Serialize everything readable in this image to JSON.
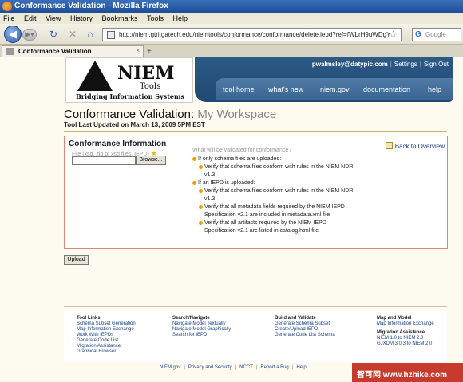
{
  "window": {
    "title": "Conformance Validation - Mozilla Firefox"
  },
  "menu": [
    "File",
    "Edit",
    "View",
    "History",
    "Bookmarks",
    "Tools",
    "Help"
  ],
  "address": {
    "url": "http://niem.gtri.gatech.edu/niemtools/conformance/conformance/delete.iepd?ref=fWLrH9uWDgY"
  },
  "search": {
    "placeholder": "Google",
    "engine_glyph": "G"
  },
  "tab": {
    "title": "Conformance Validation"
  },
  "logo": {
    "name": "NIEM",
    "sub": "Tools",
    "tagline": "Bridging Information Systems"
  },
  "header": {
    "email": "pwalmsley@datypic.com",
    "settings": "Settings",
    "signout": "Sign Out",
    "nav": [
      "tool home",
      "what's new",
      "niem.gov",
      "documentation",
      "help"
    ]
  },
  "page": {
    "title": "Conformance Validation:",
    "workspace": "My Workspace",
    "updated": "Tool Last Updated on March 13, 2009 5PM EST"
  },
  "conformance": {
    "heading": "Conformance Information",
    "file_label": "File (xsd, zip of xsd files, IEPD)",
    "browse": "Browse...",
    "what_label": "What will be validated for conformance?",
    "back": "Back to Overview",
    "rules": [
      {
        "level": 1,
        "text": "If only schema files are uploaded:"
      },
      {
        "level": 2,
        "text": "Verify that schema files conform with rules in the NIEM NDR"
      },
      {
        "level": 3,
        "text": "v1.3"
      },
      {
        "level": 1,
        "text": "If an IEPD is uploaded:"
      },
      {
        "level": 2,
        "text": "Verify that schema files conform with rules in the NIEM NDR"
      },
      {
        "level": 3,
        "text": "v1.3"
      },
      {
        "level": 2,
        "text": "Verify that all metadata fields required by the NIEM IEPD"
      },
      {
        "level": 3,
        "text": "Specification v2.1 are included in metadata.xml file"
      },
      {
        "level": 2,
        "text": "Verify that all artifacts required by the NIEM IEPD"
      },
      {
        "level": 3,
        "text": "Specification v2.1 are listed in catalog.html file"
      }
    ],
    "upload": "Upload"
  },
  "footer": {
    "columns": [
      {
        "heading": "Tool Links",
        "items": [
          "Schema Subset Generation",
          "Map Information Exchange",
          "Work With IEPDs",
          "Generate Code List",
          "Migration Assistance",
          "Graphical Browser"
        ]
      },
      {
        "heading": "Search/Navigate",
        "items": [
          "Navigate Model Textually",
          "Navigate Model Graphically",
          "Search for IEPD"
        ]
      },
      {
        "heading": "Build and Validate",
        "items": [
          "Generate Schema Subset",
          "Create/Upload IEPD",
          "Generate Code List Schema"
        ]
      },
      {
        "heading": "Map and Model",
        "items": [
          "Map Information Exchange"
        ],
        "heading2": "Migration Assistance",
        "items2": [
          "NIEM 1.0 to NIEM 2.0",
          "GJXDM 3.0.3 to NIEM 2.0"
        ]
      }
    ],
    "links": [
      "NIEM.gov",
      "Privacy and Security",
      "NCCT",
      "Report a Bug",
      "Help"
    ]
  },
  "watermark": "智可网 www.hzhike.com",
  "colors": {
    "header_band": "#1e4a72",
    "box_border": "#d88a7a",
    "link": "#1a3f8a"
  }
}
